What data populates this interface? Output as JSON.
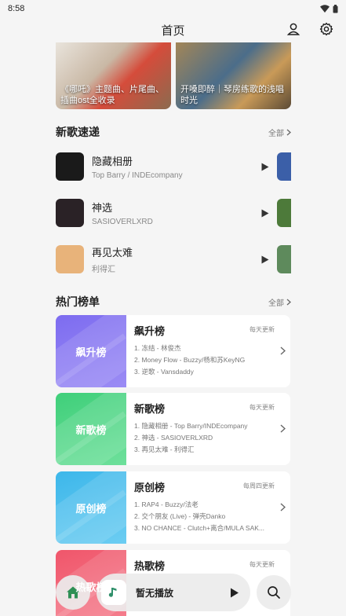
{
  "status": {
    "time": "8:58"
  },
  "header": {
    "title": "首页"
  },
  "banners": [
    {
      "text": "《哪吒》主题曲、片尾曲、插曲ost全收录"
    },
    {
      "text": "开嗓即醉｜琴房练歌的浅唱时光"
    }
  ],
  "new_songs": {
    "title": "新歌速递",
    "more": "全部",
    "items": [
      {
        "title": "隐藏相册",
        "artist": "Top Barry / INDEcompany",
        "cover_color": "#1a1a1a",
        "peek_color": "#3b5fa8"
      },
      {
        "title": "神选",
        "artist": "SASIOVERLXRD",
        "cover_color": "#2a2226",
        "peek_color": "#4d7a3a"
      },
      {
        "title": "再见太难",
        "artist": "利得汇",
        "cover_color": "#e8b37a",
        "peek_color": "#5e8a5c"
      }
    ]
  },
  "charts": {
    "title": "热门榜单",
    "more": "全部",
    "items": [
      {
        "cover_label": "飙升榜",
        "title": "飙升榜",
        "update": "每天更新",
        "color_a": "#7d6cf0",
        "color_b": "#9b8cf5",
        "tracks": [
          "1. 冻结 - 林俊杰",
          "2. Money Flow - Buzzy/杨和苏KeyNG",
          "3. 逆歌 - Vansdaddy"
        ]
      },
      {
        "cover_label": "新歌榜",
        "title": "新歌榜",
        "update": "每天更新",
        "color_a": "#3fcf7a",
        "color_b": "#6ee09b",
        "tracks": [
          "1. 隐藏相册 - Top Barry/INDEcompany",
          "2. 神选 - SASIOVERLXRD",
          "3. 再见太难 - 利得汇"
        ]
      },
      {
        "cover_label": "原创榜",
        "title": "原创榜",
        "update": "每周四更新",
        "color_a": "#3db7ea",
        "color_b": "#6ccdf2",
        "tracks": [
          "1. RAP4 - Buzzy/法老",
          "2. 交个朋友 (Live) - 弹壳Danko",
          "3. NO CHANCE - Clutch+离合/MULA SAK..."
        ]
      },
      {
        "cover_label": "热歌榜",
        "title": "热歌榜",
        "update": "每天更新",
        "color_a": "#f0566b",
        "color_b": "#f57f8e",
        "tracks": []
      }
    ]
  },
  "player": {
    "label": "暂无播放"
  }
}
